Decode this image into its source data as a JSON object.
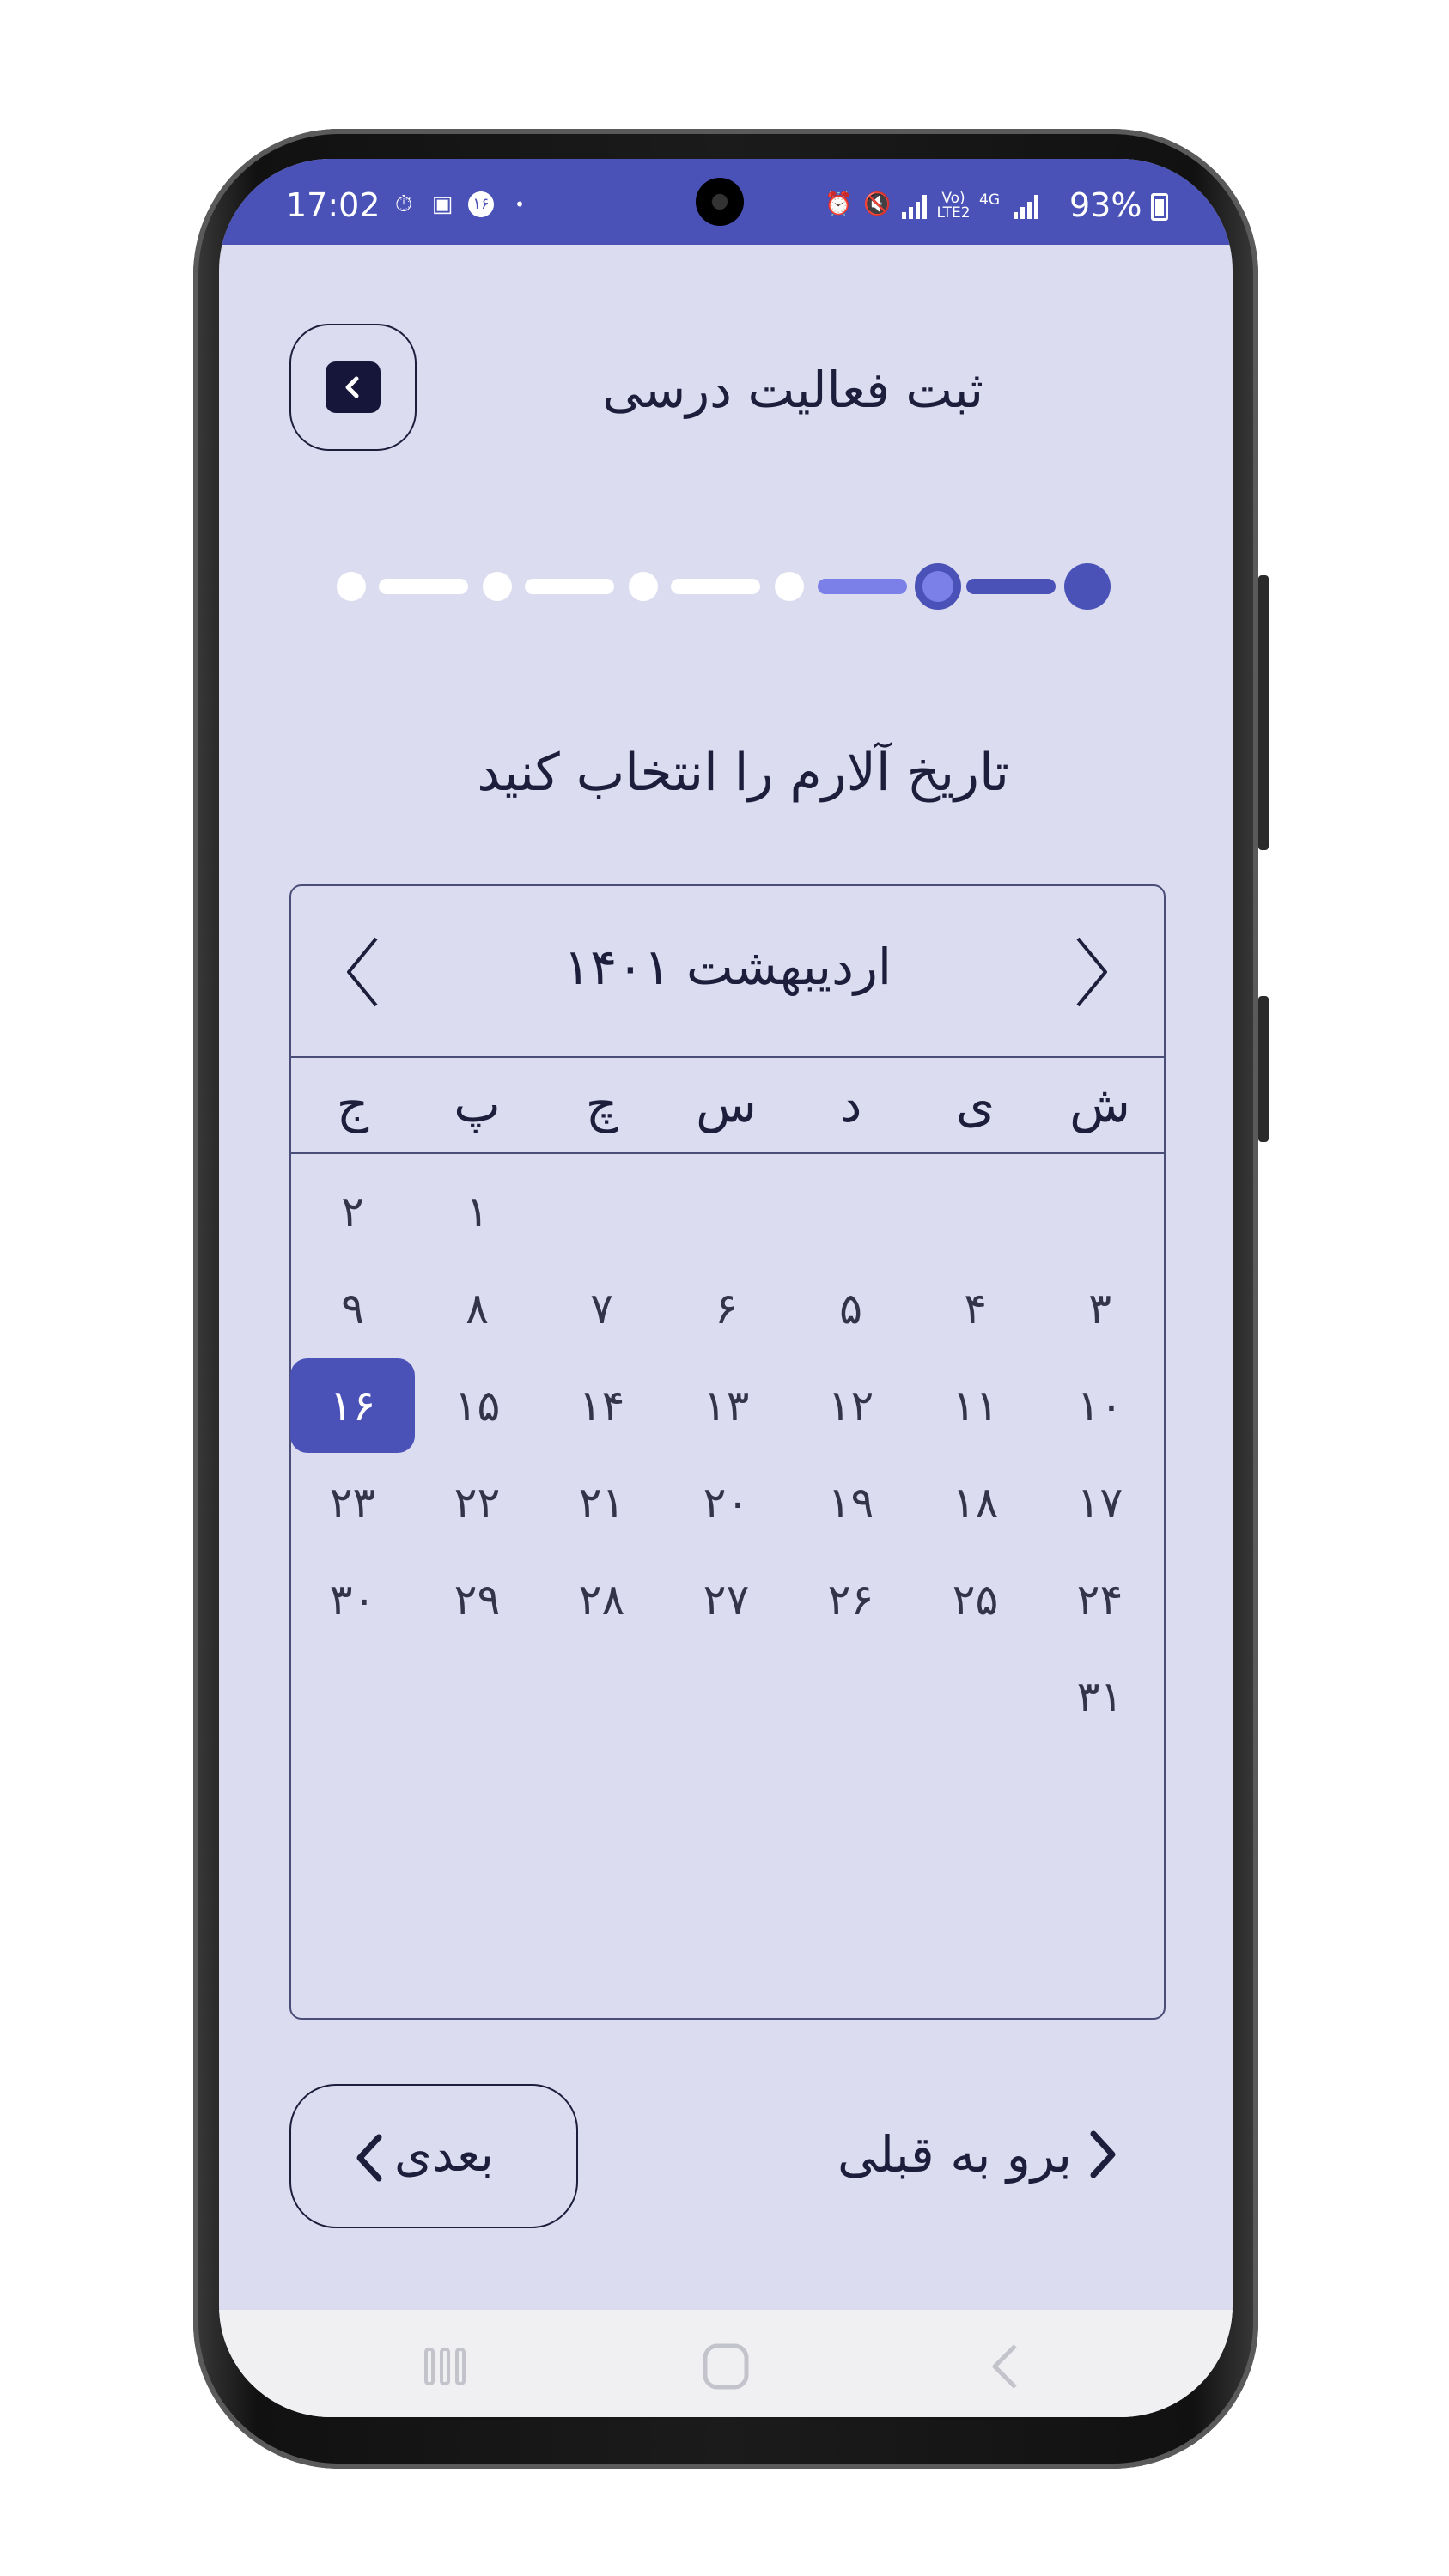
{
  "status_bar": {
    "time": "17:02",
    "notification_badge": "۱۶",
    "battery": "93%",
    "network": "4G",
    "volte": "Vo) LTE2"
  },
  "header": {
    "title": "ثبت فعالیت درسی"
  },
  "stepper": {
    "total_steps": 6,
    "completed_steps": 1,
    "current_step": 2
  },
  "question": "تاریخ آلارم را انتخاب کنید",
  "calendar": {
    "month_year": "اردیبهشت ۱۴۰۱",
    "weekdays": [
      "ش",
      "ی",
      "د",
      "س",
      "چ",
      "پ",
      "ج"
    ],
    "days": [
      "۱",
      "۲",
      "۳",
      "۴",
      "۵",
      "۶",
      "۷",
      "۸",
      "۹",
      "۱۰",
      "۱۱",
      "۱۲",
      "۱۳",
      "۱۴",
      "۱۵",
      "۱۶",
      "۱۷",
      "۱۸",
      "۱۹",
      "۲۰",
      "۲۱",
      "۲۲",
      "۲۳",
      "۲۴",
      "۲۵",
      "۲۶",
      "۲۷",
      "۲۸",
      "۲۹",
      "۳۰",
      "۳۱"
    ],
    "first_weekday_index": 5,
    "selected_day": "۱۶"
  },
  "footer": {
    "next_label": "بعدی",
    "prev_label": "برو به قبلی"
  },
  "colors": {
    "accent": "#4a52b8",
    "background": "#dbdcef",
    "text": "#1d1d3c",
    "step_inactive": "#ffffff",
    "step_progress": "#7a80e8"
  }
}
